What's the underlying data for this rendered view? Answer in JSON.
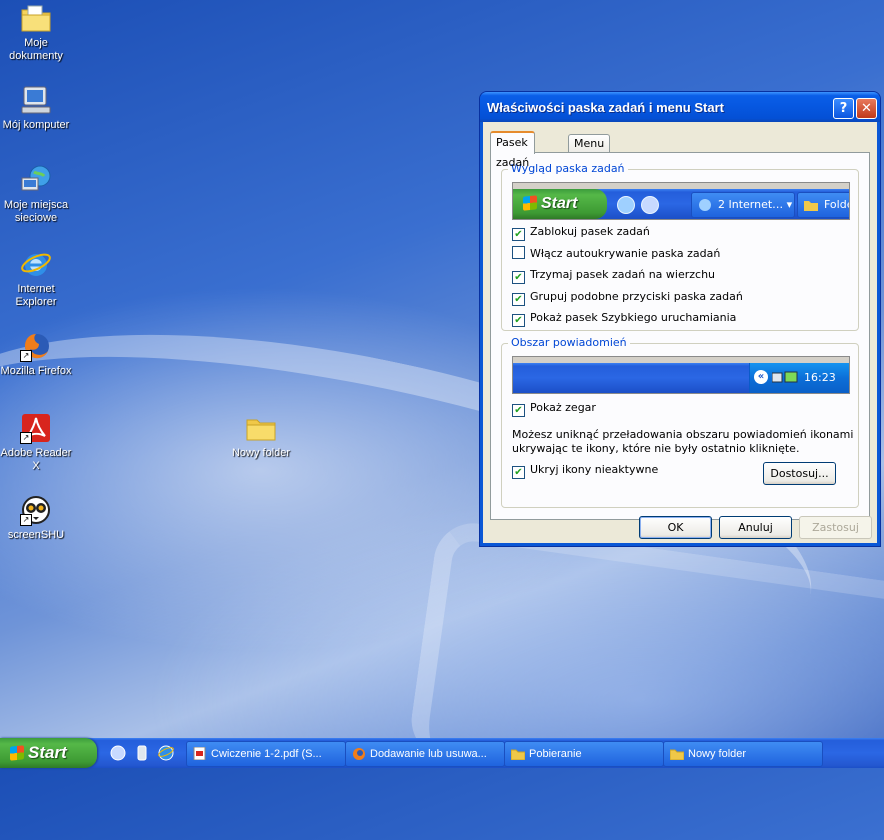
{
  "desktop": {
    "icons": [
      {
        "label": "Moje dokumenty"
      },
      {
        "label": "Mój komputer"
      },
      {
        "label": "Moje miejsca sieciowe"
      },
      {
        "label": "Internet Explorer"
      },
      {
        "label": "Mozilla Firefox"
      },
      {
        "label": "Adobe Reader X"
      },
      {
        "label": "screenSHU"
      },
      {
        "label": "Nowy folder"
      }
    ]
  },
  "dialog": {
    "title": "Właściwości paska zadań i menu Start",
    "help_glyph": "?",
    "close_glyph": "✕",
    "tabs": [
      {
        "label": "Pasek zadań",
        "active": true
      },
      {
        "label": "Menu Start",
        "active": false
      }
    ],
    "appearance": {
      "legend": "Wygląd paska zadań",
      "preview": {
        "start_label": "Start",
        "button1_label": "2 Internet…",
        "button2_label": "Folde"
      },
      "options": [
        {
          "label": "Zablokuj pasek zadań",
          "checked": true
        },
        {
          "label": "Włącz autoukrywanie paska zadań",
          "checked": false
        },
        {
          "label": "Trzymaj pasek zadań na wierzchu",
          "checked": true
        },
        {
          "label": "Grupuj podobne przyciski paska zadań",
          "checked": true
        },
        {
          "label": "Pokaż pasek Szybkiego uruchamiania",
          "checked": true
        }
      ]
    },
    "notification": {
      "legend": "Obszar powiadomień",
      "preview_clock": "16:23",
      "show_clock": {
        "label": "Pokaż zegar",
        "checked": true
      },
      "info_text_1": "Możesz uniknąć przeładowania obszaru powiadomień ikonami",
      "info_text_2": "ukrywając te ikony, które nie były ostatnio kliknięte.",
      "hide_inactive": {
        "label": "Ukryj ikony nieaktywne",
        "checked": true
      },
      "customize_label": "Dostosuj..."
    },
    "buttons": {
      "ok": "OK",
      "cancel": "Anuluj",
      "apply": "Zastosuj"
    }
  },
  "taskbar": {
    "start_label": "Start",
    "tasks": [
      {
        "label": "Cwiczenie 1-2.pdf (S...",
        "icon": "pdf-icon"
      },
      {
        "label": "Dodawanie lub usuwa...",
        "icon": "firefox-icon"
      },
      {
        "label": "Pobieranie",
        "icon": "folder-icon"
      },
      {
        "label": "Nowy folder",
        "icon": "folder-icon"
      }
    ]
  },
  "colors": {
    "xp_blue": "#0a57d6",
    "start_green": "#3d9a33",
    "legend_blue": "#0046d5",
    "check_green": "#21a121"
  }
}
